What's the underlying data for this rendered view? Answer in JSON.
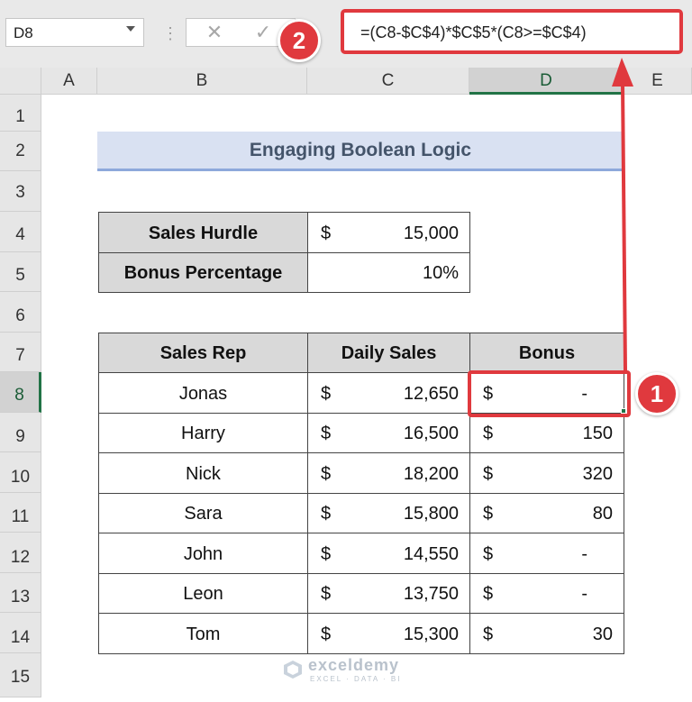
{
  "formula_bar": {
    "name_box": "D8",
    "separator": "⋮",
    "cancel_glyph": "✕",
    "enter_glyph": "✓",
    "formula": "=(C8-$C$4)*$C$5*(C8>=$C$4)"
  },
  "columns": [
    "A",
    "B",
    "C",
    "D",
    "E"
  ],
  "rows": [
    "1",
    "2",
    "3",
    "4",
    "5",
    "6",
    "7",
    "8",
    "9",
    "10",
    "11",
    "12",
    "13",
    "14",
    "15"
  ],
  "title": "Engaging Boolean Logic",
  "params": {
    "hurdle_label": "Sales Hurdle",
    "hurdle_currency": "$",
    "hurdle_value": "15,000",
    "pct_label": "Bonus Percentage",
    "pct_value": "10%"
  },
  "table": {
    "headers": [
      "Sales Rep",
      "Daily Sales",
      "Bonus"
    ],
    "rows": [
      {
        "rep": "Jonas",
        "sales": "12,650",
        "bonus": "-"
      },
      {
        "rep": "Harry",
        "sales": "16,500",
        "bonus": "150"
      },
      {
        "rep": "Nick",
        "sales": "18,200",
        "bonus": "320"
      },
      {
        "rep": "Sara",
        "sales": "15,800",
        "bonus": "80"
      },
      {
        "rep": "John",
        "sales": "14,550",
        "bonus": "-"
      },
      {
        "rep": "Leon",
        "sales": "13,750",
        "bonus": "-"
      },
      {
        "rep": "Tom",
        "sales": "15,300",
        "bonus": "30"
      }
    ],
    "currency": "$"
  },
  "callouts": {
    "one": "1",
    "two": "2"
  },
  "watermark": {
    "name": "exceldemy",
    "tagline": "EXCEL · DATA · BI"
  },
  "colors": {
    "accent_red": "#e0393e",
    "excel_green": "#217346",
    "title_fill": "#d9e1f2",
    "header_fill": "#d9d9d9"
  }
}
